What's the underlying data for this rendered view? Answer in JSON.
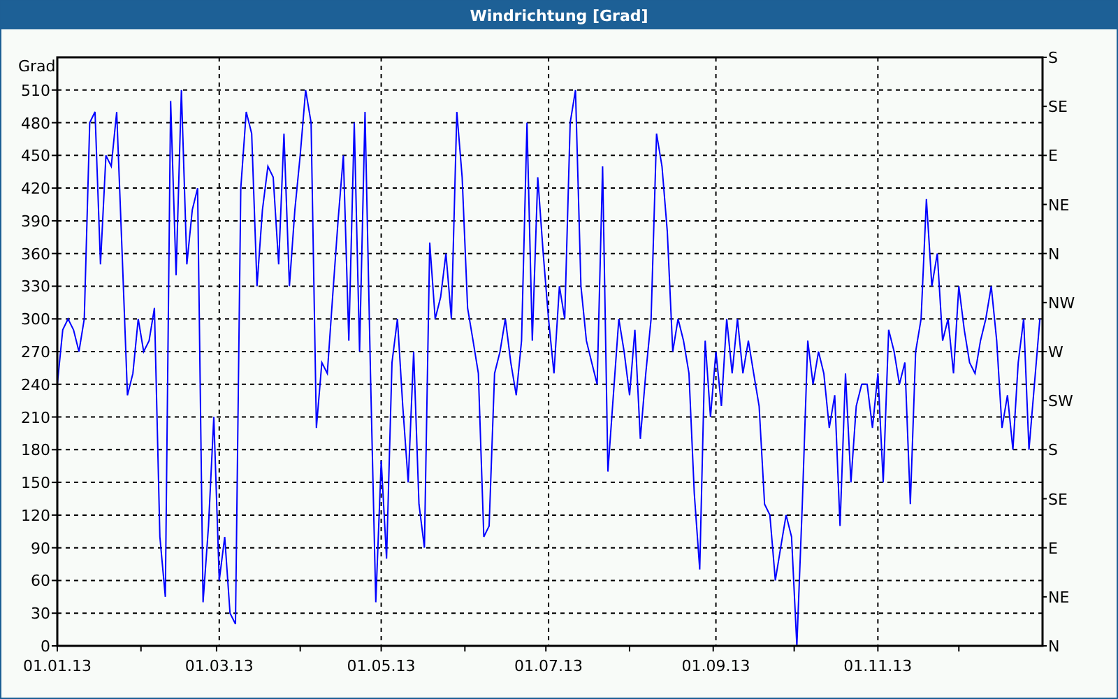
{
  "window": {
    "title": "Windrichtung [Grad]"
  },
  "chart": {
    "right_ticks": [
      "S",
      "SE",
      "E",
      "NE",
      "N",
      "NW",
      "W",
      "SW",
      "S",
      "SE",
      "E",
      "NE",
      "N"
    ],
    "chart_data": {
      "type": "line",
      "grid": true,
      "ylabel": "Grad",
      "ylim": [
        0,
        540
      ],
      "yticks": [
        0,
        30,
        60,
        90,
        120,
        150,
        180,
        210,
        240,
        270,
        300,
        330,
        360,
        390,
        420,
        450,
        480,
        510
      ],
      "categories": [
        "01.01.13",
        null,
        null,
        null,
        null,
        null,
        null,
        null,
        null,
        null,
        null,
        null,
        null,
        null,
        null,
        null,
        null,
        null,
        null,
        null,
        null,
        null,
        null,
        null,
        null,
        null,
        null,
        null,
        null,
        null,
        "01.03.13",
        null,
        null,
        null,
        null,
        null,
        null,
        null,
        null,
        null,
        null,
        null,
        null,
        null,
        null,
        null,
        null,
        null,
        null,
        null,
        null,
        null,
        null,
        null,
        null,
        null,
        null,
        null,
        null,
        null,
        "01.05.13",
        null,
        null,
        null,
        null,
        null,
        null,
        null,
        null,
        null,
        null,
        null,
        null,
        null,
        null,
        null,
        null,
        null,
        null,
        null,
        null,
        null,
        null,
        null,
        null,
        null,
        null,
        null,
        null,
        null,
        null,
        "01.07.13",
        null,
        null,
        null,
        null,
        null,
        null,
        null,
        null,
        null,
        null,
        null,
        null,
        null,
        null,
        null,
        null,
        null,
        null,
        null,
        null,
        null,
        null,
        null,
        null,
        null,
        null,
        null,
        null,
        null,
        null,
        "01.09.13",
        null,
        null,
        null,
        null,
        null,
        null,
        null,
        null,
        null,
        null,
        null,
        null,
        null,
        null,
        null,
        null,
        null,
        null,
        null,
        null,
        null,
        null,
        null,
        null,
        null,
        null,
        null,
        null,
        null,
        "01.11.13",
        null,
        null,
        null,
        null,
        null,
        null,
        null,
        null,
        null,
        null,
        null,
        null,
        null,
        null,
        null,
        null,
        null,
        null,
        null,
        null,
        null,
        null,
        null,
        null,
        null,
        null,
        null,
        null,
        null,
        null
      ],
      "series": [
        {
          "color": "#0000ff",
          "values": [
            240,
            290,
            300,
            290,
            270,
            300,
            480,
            490,
            350,
            450,
            440,
            490,
            360,
            230,
            250,
            300,
            270,
            280,
            310,
            100,
            45,
            500,
            340,
            510,
            350,
            400,
            420,
            40,
            110,
            210,
            60,
            100,
            30,
            20,
            420,
            490,
            470,
            330,
            400,
            440,
            430,
            350,
            470,
            330,
            400,
            450,
            510,
            480,
            200,
            260,
            250,
            320,
            390,
            450,
            280,
            480,
            270,
            490,
            250,
            40,
            170,
            80,
            260,
            300,
            220,
            150,
            270,
            130,
            90,
            370,
            300,
            320,
            360,
            300,
            490,
            430,
            310,
            280,
            250,
            100,
            110,
            250,
            270,
            300,
            260,
            230,
            280,
            480,
            280,
            430,
            360,
            300,
            250,
            330,
            300,
            480,
            510,
            330,
            280,
            260,
            240,
            440,
            160,
            230,
            300,
            270,
            230,
            290,
            190,
            250,
            300,
            470,
            440,
            380,
            270,
            300,
            280,
            250,
            140,
            70,
            280,
            210,
            270,
            220,
            300,
            250,
            300,
            250,
            280,
            250,
            220,
            130,
            120,
            60,
            90,
            120,
            100,
            0,
            130,
            280,
            240,
            270,
            250,
            200,
            230,
            110,
            250,
            150,
            220,
            240,
            240,
            200,
            250,
            150,
            290,
            270,
            240,
            260,
            130,
            270,
            300,
            410,
            330,
            360,
            280,
            300,
            250,
            330,
            290,
            260,
            250,
            280,
            300,
            330,
            280,
            200,
            230,
            180,
            260,
            300,
            180,
            240,
            300
          ]
        }
      ]
    }
  }
}
